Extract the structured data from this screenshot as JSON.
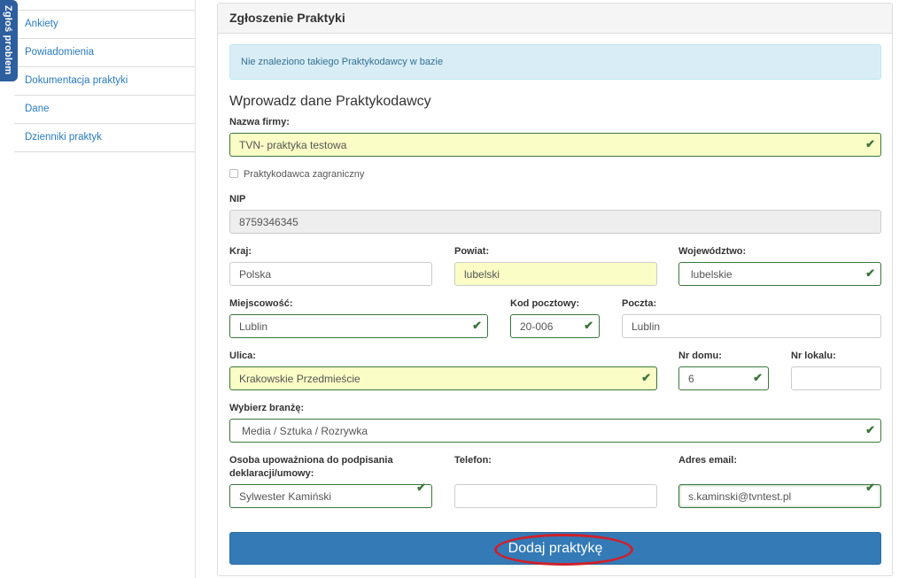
{
  "feedback_tab": {
    "label": "Zgłoś problem"
  },
  "sidebar": {
    "items": [
      {
        "label": ""
      },
      {
        "label": "Ankiety"
      },
      {
        "label": "Powiadomienia"
      },
      {
        "label": "Dokumentacja praktyki"
      },
      {
        "label": "Dane"
      },
      {
        "label": "Dzienniki praktyk"
      }
    ]
  },
  "panel": {
    "title": "Zgłoszenie Praktyki",
    "alert": "Nie znaleziono takiego Praktykodawcy w bazie",
    "section_title": "Wprowadz dane Praktykodawcy"
  },
  "form": {
    "company_name": {
      "label": "Nazwa firmy:",
      "value": "TVN- praktyka testowa"
    },
    "foreign": {
      "label": "Praktykodawca zagraniczny",
      "checked": false
    },
    "nip": {
      "label": "NIP",
      "value": "8759346345"
    },
    "country": {
      "label": "Kraj:",
      "value": "Polska"
    },
    "district": {
      "label": "Powiat:",
      "value": "lubelski"
    },
    "voivodeship": {
      "label": "Województwo:",
      "value": "lubelskie"
    },
    "city": {
      "label": "Miejscowość:",
      "value": "Lublin"
    },
    "postal_code": {
      "label": "Kod pocztowy:",
      "value": "20-006"
    },
    "post_office": {
      "label": "Poczta:",
      "value": "Lublin"
    },
    "street": {
      "label": "Ulica:",
      "value": "Krakowskie Przedmieście"
    },
    "house_no": {
      "label": "Nr domu:",
      "value": "6"
    },
    "apartment_no": {
      "label": "Nr lokalu:",
      "value": ""
    },
    "industry": {
      "label": "Wybierz branżę:",
      "value": "Media / Sztuka / Rozrywka"
    },
    "authorized_person": {
      "label": "Osoba upoważniona do podpisania deklaracji/umowy:",
      "value": "Sylwester Kamiński"
    },
    "phone": {
      "label": "Telefon:",
      "value": ""
    },
    "email": {
      "label": "Adres email:",
      "value": "s.kaminski@tvntest.pl"
    },
    "check_glyph": "✔",
    "submit_label": "Dodaj praktykę"
  },
  "colors": {
    "primary": "#337ab7",
    "valid": "#3c763d",
    "highlight": "#fafdc5",
    "annotation": "#d0202a"
  }
}
